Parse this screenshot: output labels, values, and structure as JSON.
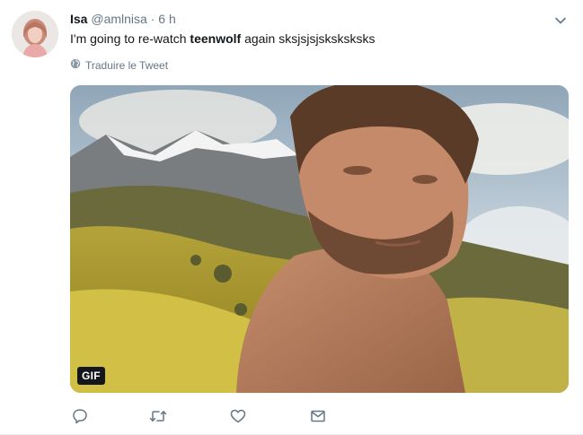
{
  "tweet": {
    "author": {
      "display_name": "Isa",
      "handle": "@amlnisa"
    },
    "separator": "·",
    "timestamp": "6 h",
    "text": {
      "before": "I'm going to re-watch ",
      "bold": "teenwolf",
      "after": " again sksjsjsjsksksksks"
    },
    "translate_label": "Traduire le Tweet",
    "media": {
      "badge": "GIF"
    }
  },
  "icons": {
    "menu": "chevron-down-icon",
    "translate": "globe-icon",
    "reply": "reply-icon",
    "retweet": "retweet-icon",
    "like": "heart-icon",
    "dm": "envelope-icon"
  },
  "colors": {
    "text": "#14171a",
    "secondary": "#657786",
    "icon": "#657786",
    "badge_bg": "#14171a"
  }
}
